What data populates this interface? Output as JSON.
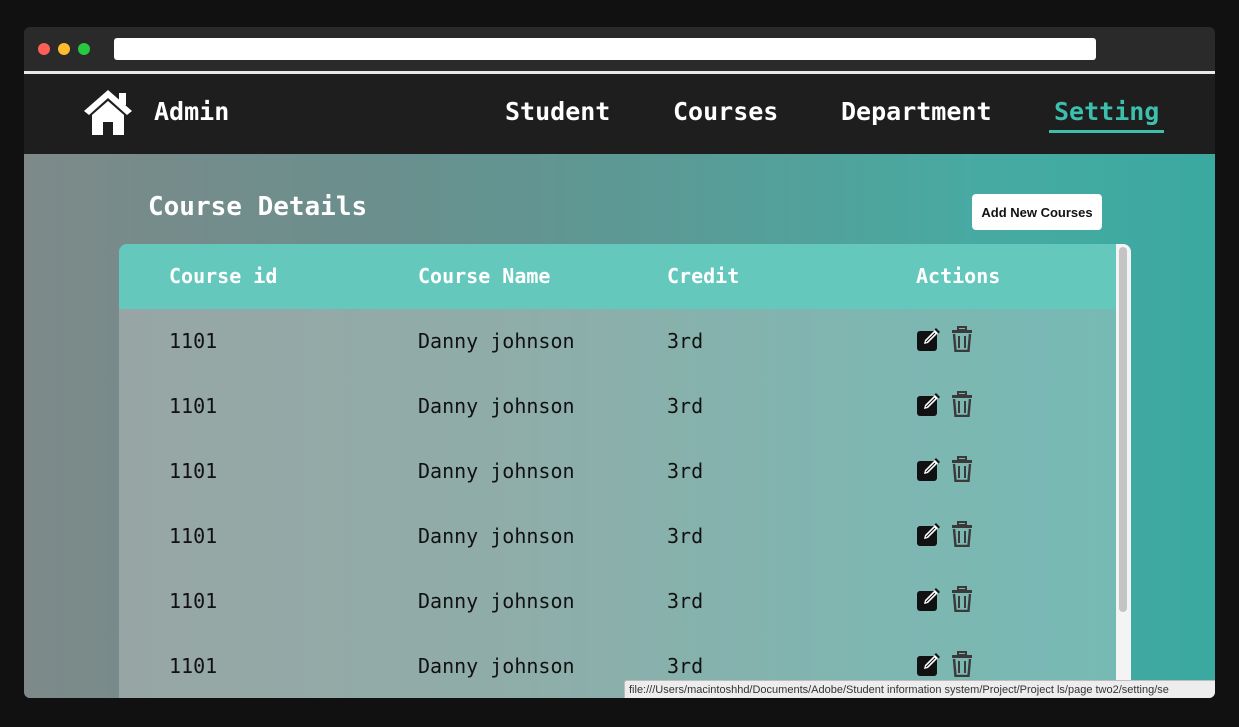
{
  "nav": {
    "brand": "Admin",
    "items": [
      {
        "label": "Student",
        "active": false
      },
      {
        "label": "Courses",
        "active": false
      },
      {
        "label": "Department",
        "active": false
      },
      {
        "label": "Setting",
        "active": true
      }
    ]
  },
  "main": {
    "title": "Course Details",
    "add_button_label": "Add New Courses"
  },
  "table": {
    "columns": [
      "Course id",
      "Course Name",
      "Credit",
      "Actions"
    ],
    "rows": [
      {
        "id": "1101",
        "name": "Danny johnson",
        "credit": "3rd"
      },
      {
        "id": "1101",
        "name": "Danny johnson",
        "credit": "3rd"
      },
      {
        "id": "1101",
        "name": "Danny johnson",
        "credit": "3rd"
      },
      {
        "id": "1101",
        "name": "Danny johnson",
        "credit": "3rd"
      },
      {
        "id": "1101",
        "name": "Danny johnson",
        "credit": "3rd"
      },
      {
        "id": "1101",
        "name": "Danny johnson",
        "credit": "3rd"
      }
    ]
  },
  "status_bar": {
    "url": "file:///Users/macintoshhd/Documents/Adobe/Student information system/Project/Project ls/page two2/setting/se"
  },
  "icons": {
    "home": "home-icon",
    "edit": "edit-icon",
    "delete": "trash-icon"
  },
  "colors": {
    "accent": "#3dbfae",
    "header_row": "#64c8bd",
    "navbar": "#1e1e1e"
  }
}
